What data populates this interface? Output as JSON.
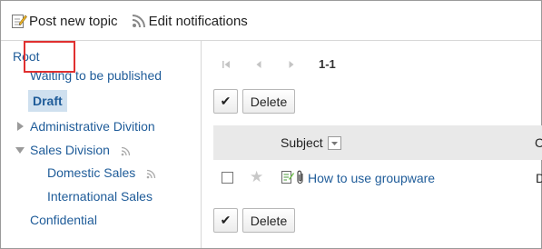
{
  "toolbar": {
    "post_label": "Post new topic",
    "edit_notifications_label": "Edit notifications"
  },
  "tree": {
    "root": "Root",
    "waiting": "Waiting to be published",
    "draft": "Draft",
    "admin": "Administrative Divition",
    "sales": "Sales Division",
    "domestic": "Domestic Sales",
    "international": "International Sales",
    "confidential": "Confidential"
  },
  "pager": {
    "count": "1-1"
  },
  "actions": {
    "delete_label": "Delete",
    "check_glyph": "✔"
  },
  "table": {
    "header_subject": "Subject",
    "header_c": "C",
    "rows": [
      {
        "subject": "How to use groupware",
        "c_cell": "D"
      }
    ]
  },
  "colors": {
    "link": "#1f5c99",
    "highlight": "#e03030",
    "selected_bg": "#cfe0ef",
    "header_bg": "#e9e9e9"
  }
}
